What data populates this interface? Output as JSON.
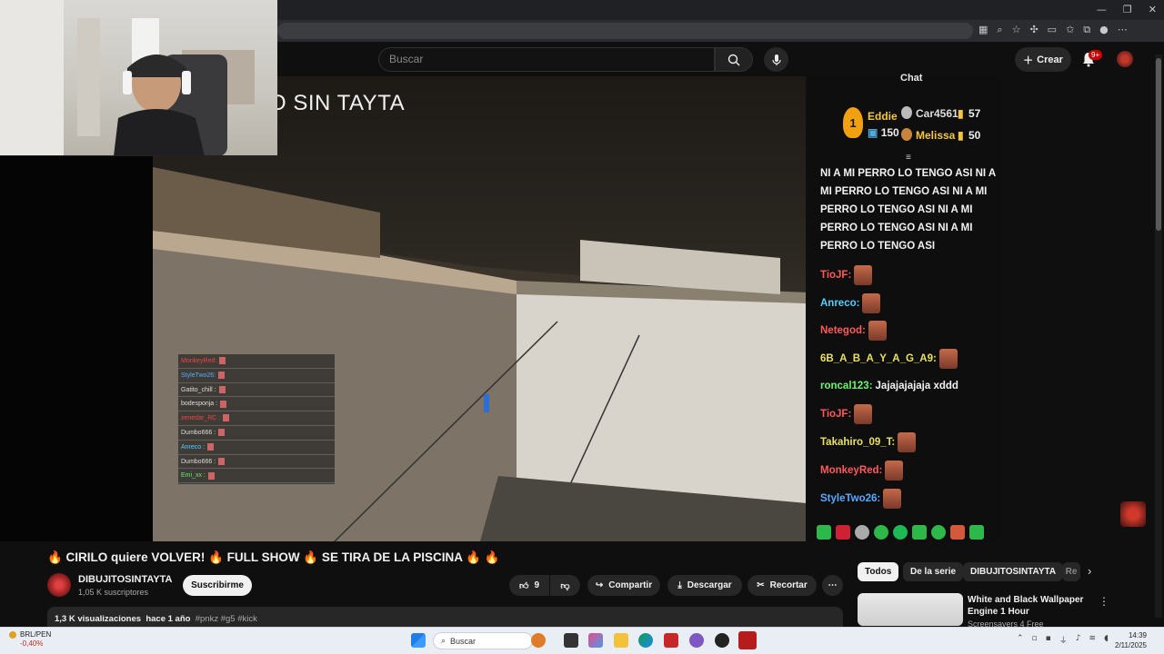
{
  "header": {
    "search_placeholder": "Buscar",
    "create_label": "Crear",
    "notif_count": "9+"
  },
  "video": {
    "overlay_title": "O SIN TAYTA",
    "mini_chat": [
      {
        "user": "MonkeyRed:",
        "color": "#e44"
      },
      {
        "user": "StyleTwo26:",
        "color": "#5af"
      },
      {
        "user": "Gatito_chill :",
        "color": "#ddd"
      },
      {
        "user": "bodesponja :",
        "color": "#ddd"
      },
      {
        "user": "zenedar_RC :",
        "color": "#e44"
      },
      {
        "user": "Dumbo666 :",
        "color": "#ddd"
      },
      {
        "user": "Anreco :",
        "color": "#5cf"
      },
      {
        "user": "Dumbo666 :",
        "color": "#ddd"
      },
      {
        "user": "Emi_xx :",
        "color": "#6e6"
      }
    ]
  },
  "chat": {
    "header": "Chat",
    "podium": {
      "first_name": "Eddie",
      "first_score": "150",
      "second_name": "Car4561",
      "second_score": "57",
      "third_name": "Melissa",
      "third_score": "50"
    },
    "message_text": "NI A MI PERRO LO TENGO ASI NI A MI PERRO LO TENGO ASI NI A MI PERRO LO TENGO ASI NI A MI PERRO LO TENGO ASI NI A MI PERRO LO TENGO ASI",
    "lines": [
      {
        "user": "TioJF:",
        "color": "#ff5a5a",
        "text": "",
        "emote": true
      },
      {
        "user": "Anreco:",
        "color": "#4fd1ff",
        "text": "",
        "emote": true
      },
      {
        "user": "Netegod:",
        "color": "#ff5a5a",
        "text": "",
        "emote": true
      },
      {
        "user": "6B_A_B_A_Y_A_G_A9:",
        "color": "#e8e060",
        "text": "",
        "emote": true
      },
      {
        "user": "roncal123:",
        "color": "#6cf56c",
        "text": "Jajajajajaja xddd",
        "emote": false
      },
      {
        "user": "TioJF:",
        "color": "#ff5a5a",
        "text": "",
        "emote": true
      },
      {
        "user": "Takahiro_09_T:",
        "color": "#e8e060",
        "text": "",
        "emote": true
      },
      {
        "user": "MonkeyRed:",
        "color": "#ff5a5a",
        "text": "",
        "emote": true
      },
      {
        "user": "StyleTwo26:",
        "color": "#5aa8ff",
        "text": "",
        "emote": true
      }
    ]
  },
  "details": {
    "title": "🔥 CIRILO quiere VOLVER! 🔥 FULL SHOW 🔥 SE TIRA DE LA PISCINA 🔥 🔥",
    "channel_name": "DIBUJITOSINTAYTA",
    "subscribers": "1,05 K suscriptores",
    "subscribe_label": "Suscribirme",
    "like_count": "9",
    "share_label": "Compartir",
    "download_label": "Descargar",
    "clip_label": "Recortar",
    "views": "1,3 K visualizaciones",
    "age": "hace 1 año",
    "hashtags": "#pnkz #g5 #kick"
  },
  "sidebar": {
    "chips": [
      "Todos",
      "De la serie",
      "DIBUJITOSINTAYTA",
      "Re"
    ],
    "rec_title": "White and Black Wallpaper Engine 1 Hour",
    "rec_channel": "Screensavers 4 Free"
  },
  "taskbar": {
    "stock_symbol": "BRL/PEN",
    "stock_change": "-0,40%",
    "search_label": "Buscar",
    "time": "14:39",
    "date": "2/11/2025"
  }
}
